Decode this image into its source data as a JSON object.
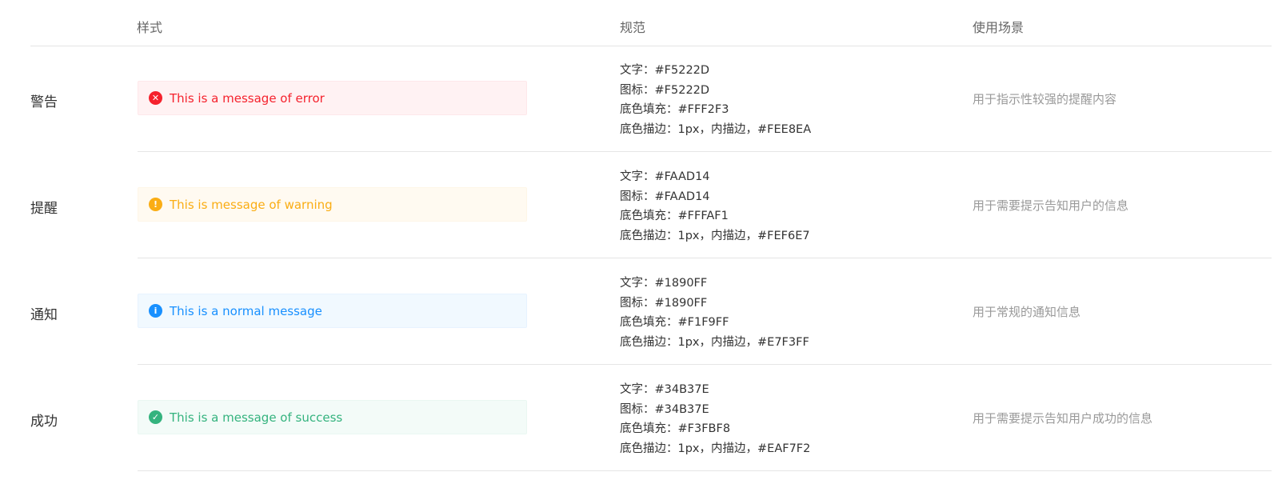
{
  "header": {
    "col_style": "样式",
    "col_spec": "规范",
    "col_usage": "使用场景"
  },
  "rows": [
    {
      "type": "警告",
      "message": "This is a message of error",
      "icon": "close-circle-icon",
      "icon_glyph": "✕",
      "colors": {
        "text": "#F5222D",
        "icon": "#F5222D",
        "fill": "#FFF2F3",
        "border": "#FEE8EA"
      },
      "spec": [
        "文字：#F5222D",
        "图标：#F5222D",
        "底色填充：#FFF2F3",
        "底色描边：1px，内描边，#FEE8EA"
      ],
      "usage": "用于指示性较强的提醒内容"
    },
    {
      "type": "提醒",
      "message": "This is message of warning",
      "icon": "exclamation-circle-icon",
      "icon_glyph": "!",
      "colors": {
        "text": "#FAAD14",
        "icon": "#FAAD14",
        "fill": "#FFFAF1",
        "border": "#FEF6E7"
      },
      "spec": [
        "文字：#FAAD14",
        "图标：#FAAD14",
        "底色填充：#FFFAF1",
        "底色描边：1px，内描边，#FEF6E7"
      ],
      "usage": "用于需要提示告知用户的信息"
    },
    {
      "type": "通知",
      "message": "This is a normal message",
      "icon": "info-circle-icon",
      "icon_glyph": "i",
      "colors": {
        "text": "#1890FF",
        "icon": "#1890FF",
        "fill": "#F1F9FF",
        "border": "#E7F3FF"
      },
      "spec": [
        "文字：#1890FF",
        "图标：#1890FF",
        "底色填充：#F1F9FF",
        "底色描边：1px，内描边，#E7F3FF"
      ],
      "usage": "用于常规的通知信息"
    },
    {
      "type": "成功",
      "message": "This is a message of success",
      "icon": "check-circle-icon",
      "icon_glyph": "✓",
      "colors": {
        "text": "#34B37E",
        "icon": "#34B37E",
        "fill": "#F3FBF8",
        "border": "#EAF7F2"
      },
      "spec": [
        "文字：#34B37E",
        "图标：#34B37E",
        "底色填充：#F3FBF8",
        "底色描边：1px，内描边，#EAF7F2"
      ],
      "usage": "用于需要提示告知用户成功的信息"
    }
  ]
}
